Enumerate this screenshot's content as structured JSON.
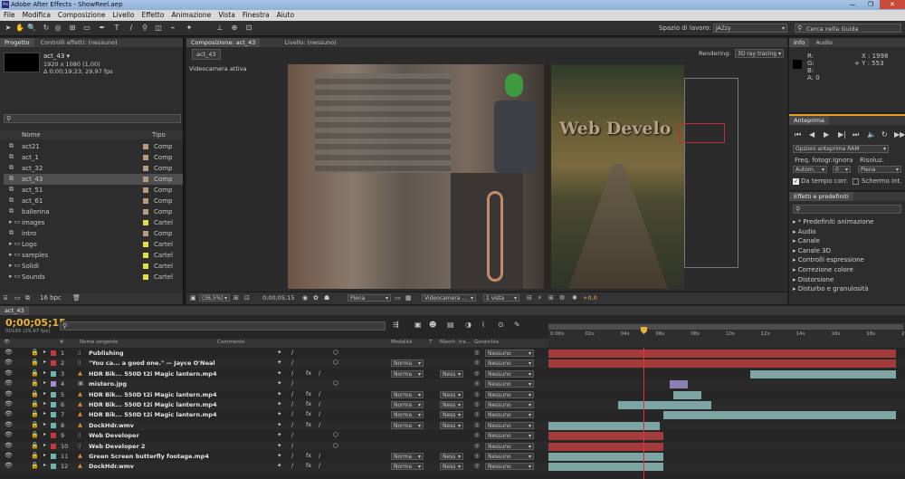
{
  "window": {
    "title": "Adobe After Effects - ShowReel.aep",
    "badge": "Ae",
    "min": "—",
    "max": "❐",
    "close": "✕"
  },
  "menu": [
    "File",
    "Modifica",
    "Composizione",
    "Livello",
    "Effetto",
    "Animazione",
    "Vista",
    "Finestra",
    "Aiuto"
  ],
  "workspace": {
    "label": "Spazio di lavoro:",
    "value": "JAZzy"
  },
  "help_search": {
    "placeholder": "Cerca nella Guida"
  },
  "project": {
    "tabs": [
      "Progetto",
      "Controlli effetti: (nessuno)"
    ],
    "selected_name": "act_43 ▾",
    "selected_info1": "1920 x 1080 (1,00)",
    "selected_info2": "Δ 0;00;19;23, 29,97 fps",
    "col_name": "Nome",
    "col_type": "Tipo",
    "items": [
      {
        "name": "act21",
        "type": "Comp",
        "color": "#b89a7a",
        "kind": "comp"
      },
      {
        "name": "act_1",
        "type": "Comp",
        "color": "#b89a7a",
        "kind": "comp"
      },
      {
        "name": "act_32",
        "type": "Comp",
        "color": "#b89a7a",
        "kind": "comp"
      },
      {
        "name": "act_43",
        "type": "Comp",
        "color": "#b89a7a",
        "kind": "comp"
      },
      {
        "name": "act_51",
        "type": "Comp",
        "color": "#b89a7a",
        "kind": "comp"
      },
      {
        "name": "act_61",
        "type": "Comp",
        "color": "#b89a7a",
        "kind": "comp"
      },
      {
        "name": "ballerina",
        "type": "Comp",
        "color": "#b89a7a",
        "kind": "comp"
      },
      {
        "name": "images",
        "type": "Cartel",
        "color": "#e6dc42",
        "kind": "folder"
      },
      {
        "name": "intro",
        "type": "Comp",
        "color": "#b89a7a",
        "kind": "comp"
      },
      {
        "name": "Logo",
        "type": "Cartel",
        "color": "#e6dc42",
        "kind": "folder"
      },
      {
        "name": "samples",
        "type": "Cartel",
        "color": "#e6dc42",
        "kind": "folder"
      },
      {
        "name": "Solidi",
        "type": "Cartel",
        "color": "#e6dc42",
        "kind": "folder"
      },
      {
        "name": "Sounds",
        "type": "Cartel",
        "color": "#e6dc42",
        "kind": "folder"
      }
    ],
    "bpc": "16 bpc"
  },
  "comp_viewer": {
    "tabs": [
      "Composizione: act_43",
      "Livello: (nessuno)"
    ],
    "subtab": "act_43",
    "rendering_label": "Rendering:",
    "rendering_value": "3D ray tracing",
    "camera_label": "Videocamera attiva",
    "overlay_text": "Web Develo",
    "zoom": "(36,5%)",
    "timecode": "0;00;05;15",
    "resolution": "Piena",
    "camera_select": "Videocamera ...",
    "views": "1 vista",
    "exposure": "+0,0"
  },
  "info": {
    "tabs": [
      "Info",
      "Audio"
    ],
    "r": "R:",
    "g": "G:",
    "b": "B:",
    "a": "A: 0",
    "x": "X : 1998",
    "y": "+ Y : 553"
  },
  "preview": {
    "tab": "Anteprima",
    "ram_options": "Opzioni anteprima RAM",
    "framerate_label": "Freq. fotogr.",
    "skip_label": "Ignora",
    "res_label": "Risoluz.",
    "framerate": "Autom.",
    "skip": "0",
    "res": "Piena",
    "from_current": "Da tempo corr.",
    "fullscreen": "Schermo int."
  },
  "effects": {
    "tab": "Effetti e predefiniti",
    "items": [
      "* Predefiniti animazione",
      "Audio",
      "Canale",
      "Canale 3D",
      "Controlli espressione",
      "Correzione colore",
      "Distorsione",
      "Disturbo e granulosità"
    ]
  },
  "timeline": {
    "tab": "act_43",
    "timecode": "0;00;05;15",
    "subtime": "00165 (29.97 fps)",
    "columns": {
      "num": "#",
      "name": "Nome sorgente",
      "comment": "Commento",
      "mode": "Modalità",
      "t": "T",
      "trkmat": "Masch. tra...",
      "parent": "Gerarchia"
    },
    "ruler": [
      "0:00s",
      "02s",
      "04s",
      "06s",
      "08s",
      "10s",
      "12s",
      "14s",
      "16s",
      "18s",
      "20"
    ],
    "layers": [
      {
        "num": "1",
        "name": "Publishing",
        "color": "#c43a3a",
        "mode": "",
        "trk": "",
        "parent": "Nessuno",
        "bars": [
          [
            0,
            100,
            "#a33b3b"
          ]
        ],
        "kind": "text"
      },
      {
        "num": "2",
        "name": "\"You ca... a good one.\" — Jayce O'Neal",
        "color": "#c43a3a",
        "mode": "Norma",
        "trk": "",
        "parent": "Nessuno",
        "bars": [
          [
            0,
            100,
            "#a33b3b"
          ]
        ],
        "kind": "text"
      },
      {
        "num": "3",
        "name": "HDR Bik... 550D t2i Magic lantern.mp4",
        "color": "#6fb3b3",
        "mode": "Norma",
        "trk": "Ness",
        "parent": "Nessuno",
        "bars": [
          [
            58,
            100,
            "#7da5a3"
          ]
        ],
        "kind": "video"
      },
      {
        "num": "4",
        "name": "mistero.jpg",
        "color": "#a58bd0",
        "mode": "",
        "trk": "",
        "parent": "Nessuno",
        "bars": [
          [
            35,
            40,
            "#8c7fb4"
          ]
        ],
        "kind": "image"
      },
      {
        "num": "5",
        "name": "HDR Bik... 550D t2i Magic lantern.mp4",
        "color": "#6fb3b3",
        "mode": "Norma",
        "trk": "Ness",
        "parent": "Nessuno",
        "bars": [
          [
            36,
            44,
            "#7da5a3"
          ]
        ],
        "kind": "video"
      },
      {
        "num": "6",
        "name": "HDR Bik... 550D t2i Magic lantern.mp4",
        "color": "#6fb3b3",
        "mode": "Norma",
        "trk": "Ness",
        "parent": "Nessuno",
        "bars": [
          [
            20,
            47,
            "#7da5a3"
          ]
        ],
        "kind": "video"
      },
      {
        "num": "7",
        "name": "HDR Bik... 550D t2i Magic lantern.mp4",
        "color": "#6fb3b3",
        "mode": "Norma",
        "trk": "Ness",
        "parent": "Nessuno",
        "bars": [
          [
            33,
            100,
            "#7da5a3"
          ]
        ],
        "kind": "video"
      },
      {
        "num": "8",
        "name": "DockHdr.wmv",
        "color": "#6fb3b3",
        "mode": "Norma",
        "trk": "Ness",
        "parent": "Nessuno",
        "bars": [
          [
            0,
            32,
            "#7da5a3"
          ]
        ],
        "kind": "video"
      },
      {
        "num": "9",
        "name": "Web Developer",
        "color": "#c43a3a",
        "mode": "",
        "trk": "",
        "parent": "Nessuno",
        "bars": [
          [
            0,
            33,
            "#a33b3b"
          ]
        ],
        "kind": "text"
      },
      {
        "num": "10",
        "name": "Web Developer 2",
        "color": "#c43a3a",
        "mode": "",
        "trk": "",
        "parent": "Nessuno",
        "bars": [
          [
            0,
            33,
            "#a33b3b"
          ]
        ],
        "kind": "text"
      },
      {
        "num": "11",
        "name": "Green Screen butterfly footage.mp4",
        "color": "#6fb3b3",
        "mode": "Norma",
        "trk": "Ness",
        "parent": "Nessuno",
        "bars": [
          [
            0,
            33,
            "#7da5a3"
          ]
        ],
        "kind": "video"
      },
      {
        "num": "12",
        "name": "DockHdr.wmv",
        "color": "#6fb3b3",
        "mode": "Norma",
        "trk": "Ness",
        "parent": "Nessuno",
        "bars": [
          [
            0,
            33,
            "#7da5a3"
          ]
        ],
        "kind": "video"
      }
    ]
  }
}
